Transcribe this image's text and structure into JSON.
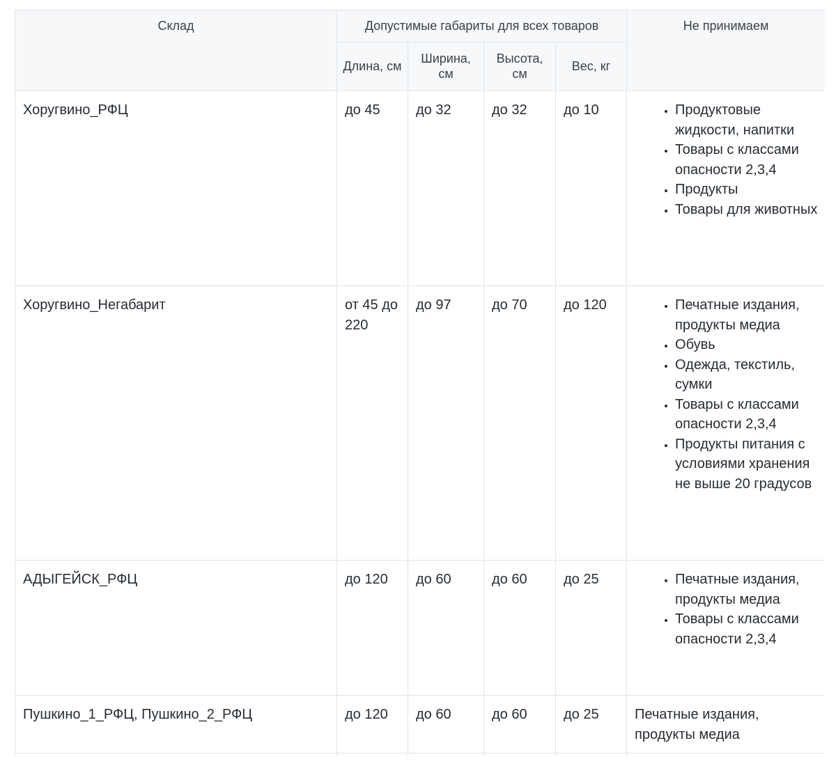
{
  "table": {
    "headers": {
      "warehouse": "Склад",
      "dimensions_group": "Допустимые габариты для всех товаров",
      "not_accepted": "Не принимаем",
      "length": "Длина, см",
      "width": "Ширина, см",
      "height": "Высота, см",
      "weight": "Вес, кг"
    },
    "rows": [
      {
        "warehouse": "Хоругвино_РФЦ",
        "length": "до 45",
        "width": "до 32",
        "height": "до 32",
        "weight": "до 10",
        "not_accepted": [
          "Продуктовые жидкости, напитки",
          "Товары с классами опасности 2,3,4",
          "Продукты",
          "Товары для животных"
        ]
      },
      {
        "warehouse": "Хоругвино_Негабарит",
        "length": "от 45 до 220",
        "width": "до 97",
        "height": "до 70",
        "weight": "до 120",
        "not_accepted": [
          "Печатные издания, продукты медиа",
          "Обувь",
          "Одежда, текстиль, сумки",
          "Товары с классами опасности 2,3,4",
          "Продукты питания с условиями хранения не выше 20 градусов"
        ]
      },
      {
        "warehouse": "АДЫГЕЙСК_РФЦ",
        "length": "до 120",
        "width": "до 60",
        "height": "до 60",
        "weight": "до 25",
        "not_accepted": [
          "Печатные издания, продукты медиа",
          "Товары с классами опасности 2,3,4"
        ]
      },
      {
        "warehouse": "Пушкино_1_РФЦ, Пушкино_2_РФЦ",
        "length": "до 120",
        "width": "до 60",
        "height": "до 60",
        "weight": "до 25",
        "not_accepted_text": "Печатные издания, продукты медиа"
      }
    ]
  }
}
